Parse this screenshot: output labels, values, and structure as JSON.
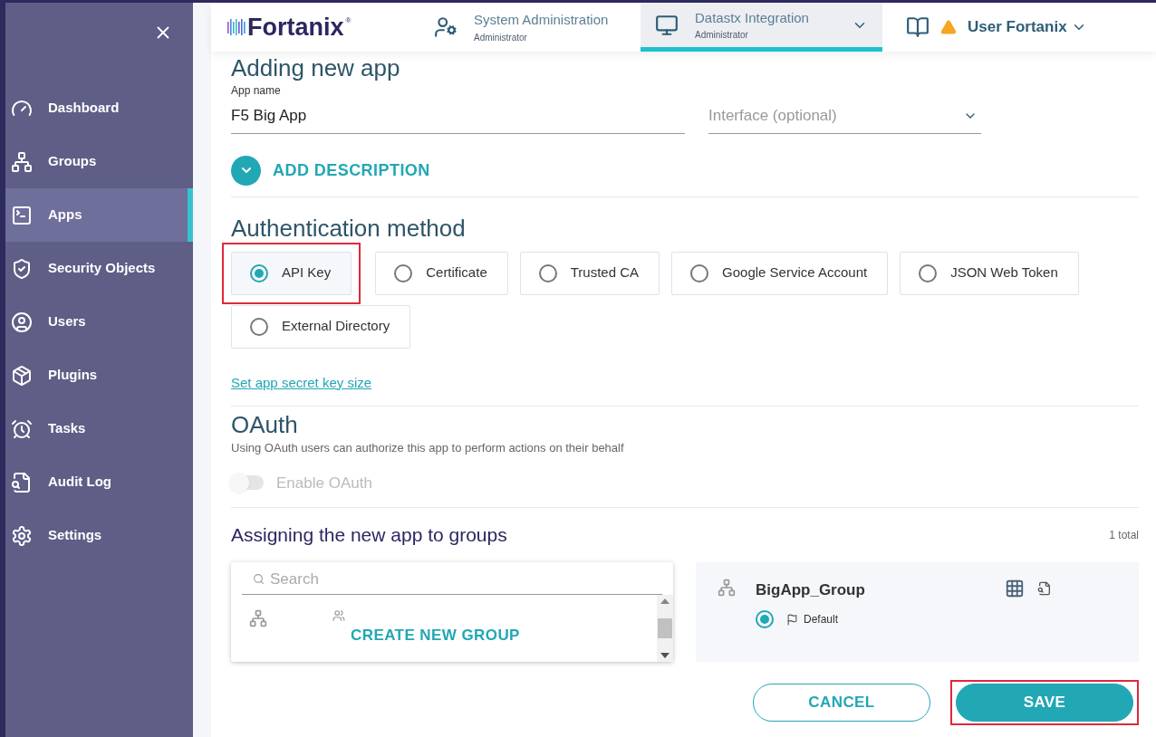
{
  "sidebar": {
    "items": [
      {
        "label": "Dashboard",
        "selected": false
      },
      {
        "label": "Groups",
        "selected": false
      },
      {
        "label": "Apps",
        "selected": true
      },
      {
        "label": "Security Objects",
        "selected": false
      },
      {
        "label": "Users",
        "selected": false
      },
      {
        "label": "Plugins",
        "selected": false
      },
      {
        "label": "Tasks",
        "selected": false
      },
      {
        "label": "Audit Log",
        "selected": false
      },
      {
        "label": "Settings",
        "selected": false
      }
    ]
  },
  "header": {
    "logo": "Fortanix",
    "logo_mark": "®",
    "accounts": [
      {
        "title": "System Administration",
        "role": "Administrator",
        "selected": false,
        "dropdown": false
      },
      {
        "title": "Datastx Integration",
        "role": "Administrator",
        "selected": true,
        "dropdown": true
      }
    ],
    "user": "User Fortanix",
    "warning": true
  },
  "form": {
    "title": "Adding new app",
    "app_name": {
      "label": "App name",
      "value": "F5 Big App"
    },
    "interface": {
      "placeholder": "Interface (optional)"
    },
    "add_description": "ADD DESCRIPTION",
    "auth_title": "Authentication method",
    "auth_methods": [
      {
        "label": "API Key",
        "selected": true,
        "highlighted": true
      },
      {
        "label": "Certificate",
        "selected": false,
        "highlighted": false
      },
      {
        "label": "Trusted CA",
        "selected": false,
        "highlighted": false
      },
      {
        "label": "Google Service Account",
        "selected": false,
        "highlighted": false
      },
      {
        "label": "JSON Web Token",
        "selected": false,
        "highlighted": false
      },
      {
        "label": "External Directory",
        "selected": false,
        "highlighted": false
      }
    ],
    "secret_link": "Set app secret key size",
    "oauth": {
      "title": "OAuth",
      "description": "Using OAuth users can authorize this app to perform actions on their behalf",
      "toggle_label": "Enable OAuth",
      "on": false,
      "disabled": true
    },
    "groups": {
      "title": "Assigning the new app to groups",
      "total": "1 total",
      "search_placeholder": "Search",
      "create_label": "CREATE NEW GROUP",
      "assigned": [
        {
          "name": "BigApp_Group",
          "selected": true,
          "tag": "Default"
        }
      ]
    },
    "buttons": [
      {
        "label": "CANCEL",
        "kind": "outline",
        "highlighted": false
      },
      {
        "label": "SAVE",
        "kind": "primary",
        "highlighted": true
      }
    ]
  }
}
